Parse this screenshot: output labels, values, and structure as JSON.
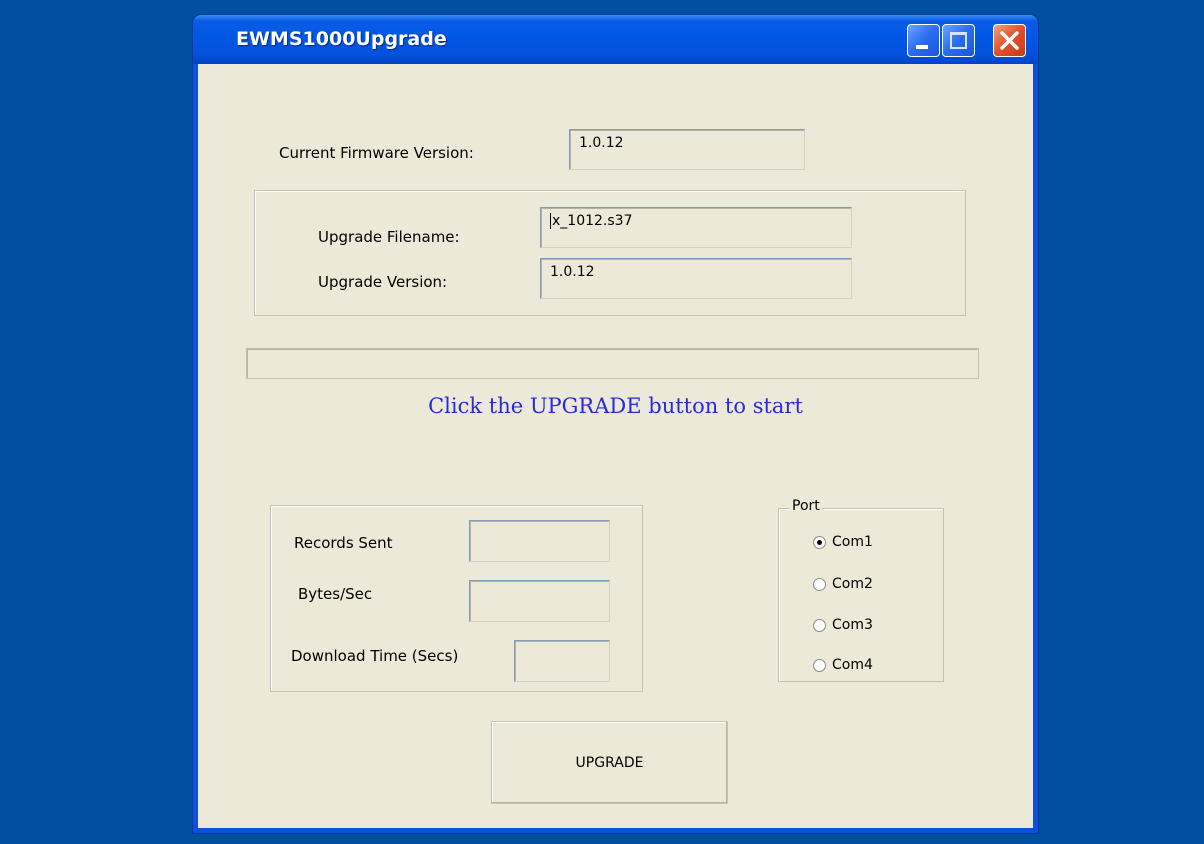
{
  "window": {
    "title": "EWMS1000Upgrade"
  },
  "firmware": {
    "current_label": "Current Firmware Version:",
    "current_value": "1.0.12",
    "upgrade_filename_label": "Upgrade Filename:",
    "upgrade_filename_value": "x_1012.s37",
    "upgrade_version_label": "Upgrade Version:",
    "upgrade_version_value": "1.0.12"
  },
  "progress": {
    "fraction": 0
  },
  "status_message": "Click the UPGRADE button to start",
  "stats": {
    "records_sent_label": "Records Sent",
    "records_sent_value": "",
    "bytes_sec_label": "Bytes/Sec",
    "bytes_sec_value": "",
    "download_time_label": "Download Time (Secs)",
    "download_time_value": ""
  },
  "port": {
    "legend": "Port",
    "options": [
      {
        "label": "Com1",
        "checked": true
      },
      {
        "label": "Com2",
        "checked": false
      },
      {
        "label": "Com3",
        "checked": false
      },
      {
        "label": "Com4",
        "checked": false
      }
    ]
  },
  "upgrade_button": {
    "label": "UPGRADE"
  }
}
